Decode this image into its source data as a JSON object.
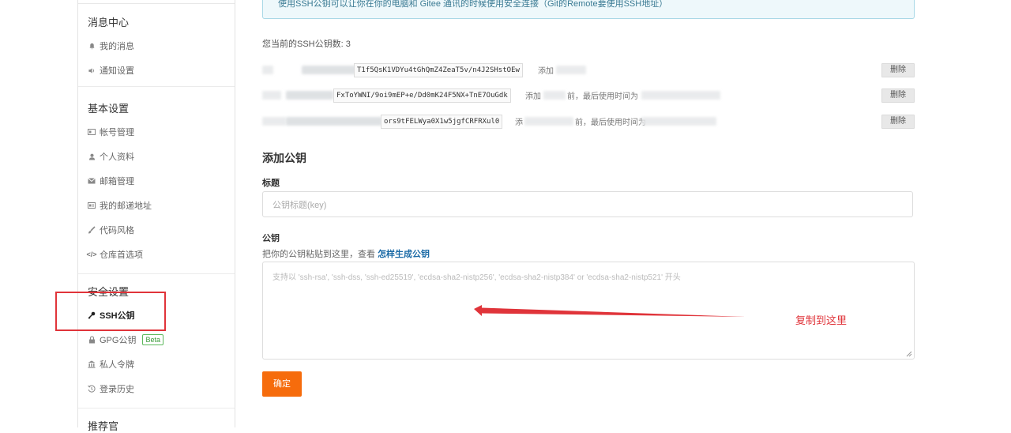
{
  "sidebar": {
    "sections": [
      {
        "title": "消息中心",
        "items": [
          {
            "icon": "bell-icon",
            "label": "我的消息"
          },
          {
            "icon": "volume-icon",
            "label": "通知设置"
          }
        ]
      },
      {
        "title": "基本设置",
        "items": [
          {
            "icon": "id-card-icon",
            "label": "帐号管理"
          },
          {
            "icon": "user-icon",
            "label": "个人资料"
          },
          {
            "icon": "envelope-icon",
            "label": "邮箱管理"
          },
          {
            "icon": "address-card-icon",
            "label": "我的邮递地址"
          },
          {
            "icon": "brush-icon",
            "label": "代码风格"
          },
          {
            "icon": "code-icon",
            "label": "仓库首选项"
          }
        ]
      },
      {
        "title": "安全设置",
        "items": [
          {
            "icon": "key-icon",
            "label": "SSH公钥",
            "active": true
          },
          {
            "icon": "lock-icon",
            "label": "GPG公钥",
            "badge": "Beta"
          },
          {
            "icon": "bank-icon",
            "label": "私人令牌"
          },
          {
            "icon": "history-icon",
            "label": "登录历史"
          }
        ]
      },
      {
        "title": "推荐官"
      }
    ]
  },
  "main": {
    "info": "使用SSH公钥可以让你在你的电脑和 Gitee 通讯的时候使用安全连接（Git的Remote要使用SSH地址）",
    "count_label": "您当前的SSH公钥数: 3",
    "keys": [
      {
        "fingerprint": "T1f5QsK1VDYu4tGhQmZ4ZeaT5v/n4J2SHstOEw",
        "suffix": "添加",
        "delete": "删除"
      },
      {
        "fingerprint": "FxToYWNI/9oi9mEP+e/Dd0mK24F5NX+TnE7OuGdk",
        "suffix": "添加",
        "mid": "前，最后使用时间为",
        "delete": "删除"
      },
      {
        "fingerprint": "ors9tFELWya0X1w5jgfCRFRXul0",
        "suffix": "添",
        "mid": "前，最后使用时间为",
        "delete": "删除"
      }
    ],
    "add_heading": "添加公钥",
    "title_label": "标题",
    "title_placeholder": "公钥标题(key)",
    "pubkey_label": "公钥",
    "pubkey_hint": "把你的公钥粘贴到这里，查看",
    "pubkey_hint_link": "怎样生成公钥",
    "pubkey_placeholder": "支持以 'ssh-rsa', 'ssh-dss, 'ssh-ed25519', 'ecdsa-sha2-nistp256', 'ecdsa-sha2-nistp384' or 'ecdsa-sha2-nistp521' 开头",
    "submit": "确定"
  },
  "annotation": {
    "text": "复制到这里",
    "color": "#e0343a"
  },
  "colors": {
    "accent": "#f66c0c",
    "info_bg": "#eef8fb",
    "link": "#1a6aa6"
  }
}
